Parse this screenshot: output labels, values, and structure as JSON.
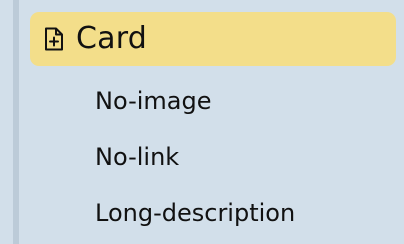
{
  "tree": {
    "parent": {
      "label": "Card",
      "icon": "file-plus-icon"
    },
    "children": [
      {
        "label": "No-image"
      },
      {
        "label": "No-link"
      },
      {
        "label": "Long-description"
      }
    ]
  },
  "colors": {
    "background": "#d2dfea",
    "selected_highlight": "#f3de8a",
    "guide_line": "#bccbd8",
    "text": "#111111"
  }
}
